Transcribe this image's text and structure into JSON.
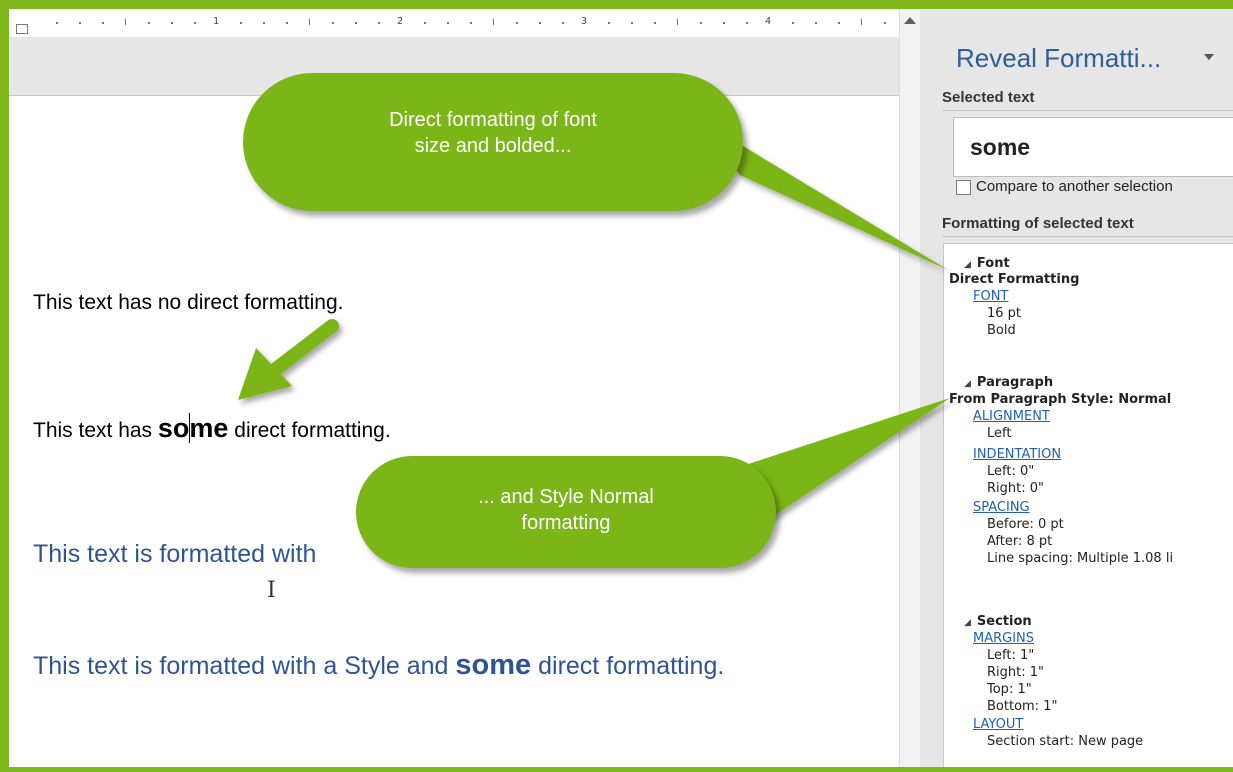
{
  "ruler": {
    "numbers": [
      "1",
      "2",
      "3",
      "4"
    ]
  },
  "document": {
    "line1": "This text has no direct formatting.",
    "line2_before": "This text has ",
    "line2_bold_a": "so",
    "line2_bold_b": "me",
    "line2_after": " direct formatting.",
    "line3": "This text is formatted with",
    "line4_before": "This text is formatted with a Style and ",
    "line4_bold": "some",
    "line4_after": " direct formatting."
  },
  "callouts": {
    "top_line1": "Direct formatting of font",
    "top_line2": "size and bolded...",
    "bottom_line1": "... and Style Normal",
    "bottom_line2": "formatting"
  },
  "panel": {
    "title": "Reveal Formatti...",
    "selected_text_label": "Selected text",
    "selected_text_value": "some",
    "compare_label": "Compare to another selection",
    "formatting_label": "Formatting of selected text",
    "font": {
      "header": "Font",
      "subheader": "Direct Formatting",
      "link": "FONT",
      "values": [
        "16 pt",
        "Bold"
      ]
    },
    "paragraph": {
      "header": "Paragraph",
      "subheader": "From Paragraph Style: Normal",
      "alignment_link": "ALIGNMENT",
      "alignment_values": [
        "Left"
      ],
      "indentation_link": "INDENTATION",
      "indentation_values": [
        "Left:  0\"",
        "Right:  0\""
      ],
      "spacing_link": "SPACING",
      "spacing_values": [
        "Before:  0 pt",
        "After:  8 pt",
        "Line spacing:  Multiple 1.08 li"
      ]
    },
    "section": {
      "header": "Section",
      "margins_link": "MARGINS",
      "margins_values": [
        "Left:  1\"",
        "Right:  1\"",
        "Top:  1\"",
        "Bottom:  1\""
      ],
      "layout_link": "LAYOUT",
      "layout_values": [
        "Section start: New page"
      ]
    }
  },
  "colors": {
    "frame": "#80b71d",
    "callout": "#7cb518",
    "style_text": "#2f5496",
    "panel_title": "#2e5d9a",
    "link": "#1f5fb8"
  }
}
